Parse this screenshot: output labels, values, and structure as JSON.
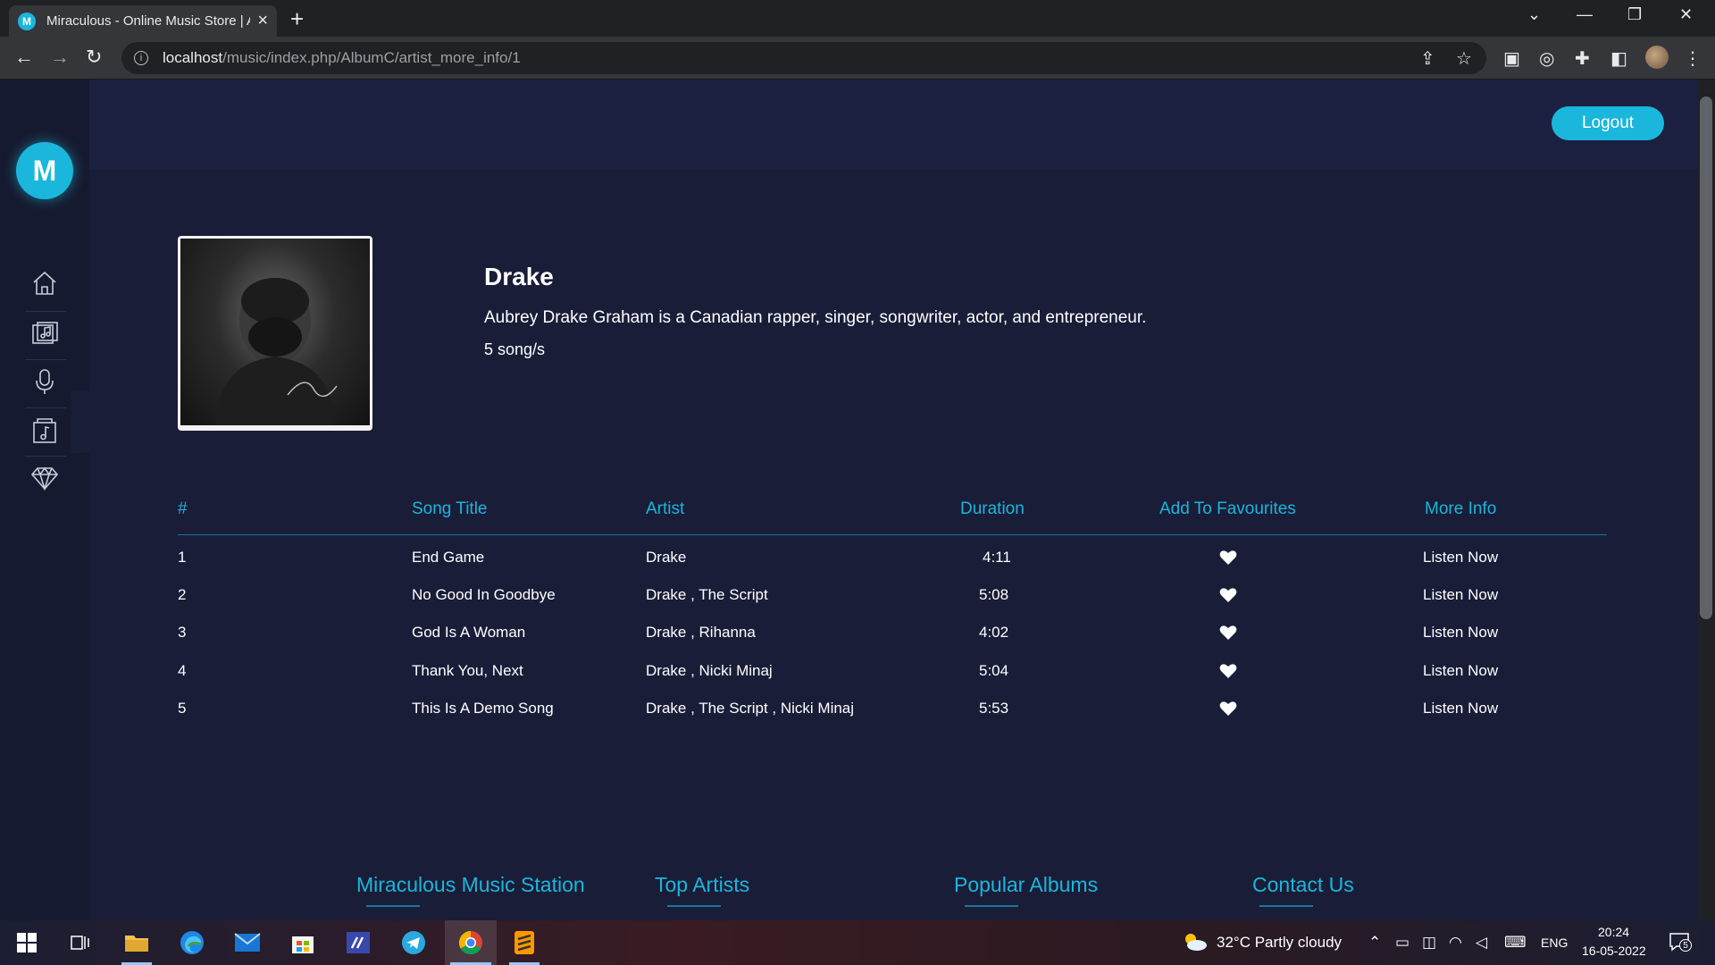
{
  "browser": {
    "tab_title": "Miraculous - Online Music Store | Artist",
    "favicon_letter": "M",
    "url_host": "localhost",
    "url_path": "/music/index.php/AlbumC/artist_more_info/1"
  },
  "app": {
    "logo_letter": "M",
    "logout_label": "Logout",
    "accent_color": "#1bb6db",
    "sidebar_icons": [
      "home-icon",
      "music-album-icon",
      "microphone-icon",
      "music-file-icon",
      "diamond-icon"
    ]
  },
  "artist": {
    "name": "Drake",
    "description": "Aubrey Drake Graham is a Canadian rapper, singer, songwriter, actor, and entrepreneur.",
    "song_count": "5 song/s"
  },
  "table": {
    "headers": {
      "num": "#",
      "title": "Song Title",
      "artist": "Artist",
      "duration": "Duration",
      "fav": "Add To Favourites",
      "more": "More Info"
    },
    "rows": [
      {
        "num": "1",
        "title": "End Game",
        "artist": "Drake",
        "duration": "4:11",
        "more": "Listen Now"
      },
      {
        "num": "2",
        "title": "No Good In Goodbye",
        "artist": "Drake , The Script",
        "duration": "5:08",
        "more": "Listen Now"
      },
      {
        "num": "3",
        "title": "God Is A Woman",
        "artist": "Drake , Rihanna",
        "duration": "4:02",
        "more": "Listen Now"
      },
      {
        "num": "4",
        "title": "Thank You, Next",
        "artist": "Drake , Nicki Minaj",
        "duration": "5:04",
        "more": "Listen Now"
      },
      {
        "num": "5",
        "title": "This Is A Demo Song",
        "artist": "Drake , The Script , Nicki Minaj",
        "duration": "5:53",
        "more": "Listen Now"
      }
    ]
  },
  "footer": {
    "station": "Miraculous Music Station",
    "top_artists": "Top Artists",
    "popular_albums": "Popular Albums",
    "contact": "Contact Us"
  },
  "taskbar": {
    "weather": "32°C  Partly cloudy",
    "lang": "ENG",
    "time": "20:24",
    "date": "16-05-2022",
    "notif_count": "5"
  }
}
